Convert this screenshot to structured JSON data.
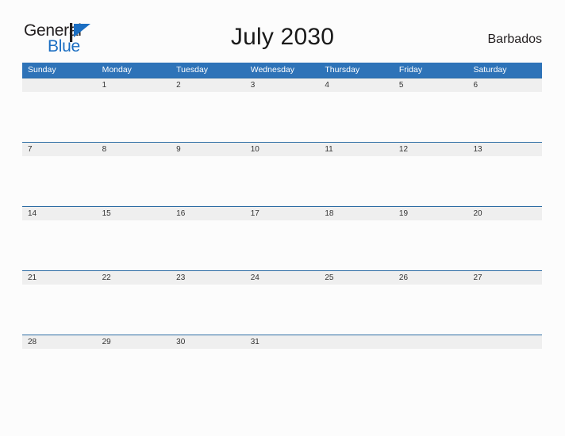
{
  "brand": {
    "name_part1": "General",
    "name_part2": "Blue",
    "mark": "triangle-flag-icon",
    "accent_color": "#1b6ec2"
  },
  "header": {
    "title": "July 2030",
    "location": "Barbados"
  },
  "calendar": {
    "header_color": "#2e73b8",
    "band_color": "#efefef",
    "band_border_color": "#2e6da4",
    "weekdays": [
      "Sunday",
      "Monday",
      "Tuesday",
      "Wednesday",
      "Thursday",
      "Friday",
      "Saturday"
    ],
    "weeks": [
      [
        "",
        "1",
        "2",
        "3",
        "4",
        "5",
        "6"
      ],
      [
        "7",
        "8",
        "9",
        "10",
        "11",
        "12",
        "13"
      ],
      [
        "14",
        "15",
        "16",
        "17",
        "18",
        "19",
        "20"
      ],
      [
        "21",
        "22",
        "23",
        "24",
        "25",
        "26",
        "27"
      ],
      [
        "28",
        "29",
        "30",
        "31",
        "",
        "",
        ""
      ]
    ]
  }
}
